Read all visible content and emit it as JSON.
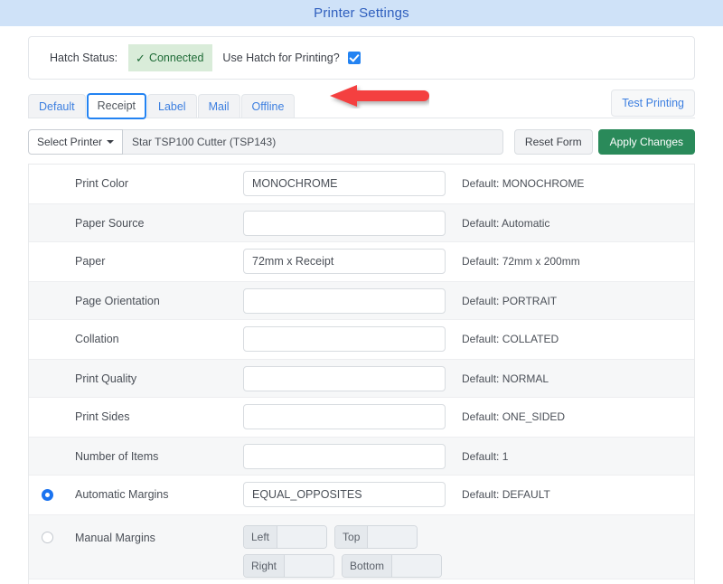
{
  "window": {
    "title": "Printer Settings"
  },
  "status": {
    "label": "Hatch Status:",
    "badge_text": "Connected",
    "badge_icon": "check-icon",
    "use_hatch_label": "Use Hatch for Printing?",
    "use_hatch_checked": true,
    "annotation_icon": "red-left-arrow"
  },
  "tabs": {
    "items": [
      {
        "label": "Default",
        "active": false
      },
      {
        "label": "Receipt",
        "active": true
      },
      {
        "label": "Label",
        "active": false
      },
      {
        "label": "Mail",
        "active": false
      },
      {
        "label": "Offline",
        "active": false
      }
    ],
    "test_printing_label": "Test Printing"
  },
  "printer_bar": {
    "select_printer_label": "Select Printer",
    "selected_printer": "Star TSP100 Cutter (TSP143)",
    "reset_label": "Reset Form",
    "apply_label": "Apply Changes"
  },
  "settings": {
    "rows": [
      {
        "label": "Print Color",
        "value": "MONOCHROME",
        "default": "Default: MONOCHROME"
      },
      {
        "label": "Paper Source",
        "value": "",
        "default": "Default: Automatic"
      },
      {
        "label": "Paper",
        "value": "72mm x Receipt",
        "default": "Default: 72mm x 200mm"
      },
      {
        "label": "Page Orientation",
        "value": "",
        "default": "Default: PORTRAIT"
      },
      {
        "label": "Collation",
        "value": "",
        "default": "Default: COLLATED"
      },
      {
        "label": "Print Quality",
        "value": "",
        "default": "Default: NORMAL"
      },
      {
        "label": "Print Sides",
        "value": "",
        "default": "Default: ONE_SIDED"
      },
      {
        "label": "Number of Items",
        "value": "",
        "default": "Default: 1"
      }
    ],
    "automatic_margins": {
      "label": "Automatic Margins",
      "value": "EQUAL_OPPOSITES",
      "default": "Default: DEFAULT",
      "selected": true
    },
    "manual_margins": {
      "label": "Manual Margins",
      "selected": false,
      "fields": [
        {
          "label": "Left",
          "value": ""
        },
        {
          "label": "Top",
          "value": ""
        },
        {
          "label": "Right",
          "value": ""
        },
        {
          "label": "Bottom",
          "value": ""
        }
      ]
    }
  },
  "colors": {
    "title_bar": "#cfe2f8",
    "title_text": "#2f5fbe",
    "accent_blue": "#2383f2",
    "success_green": "#2a8a5a",
    "badge_bg": "#d9ecd9",
    "badge_text": "#1e6b36",
    "annotation_red": "#f43f3f"
  }
}
